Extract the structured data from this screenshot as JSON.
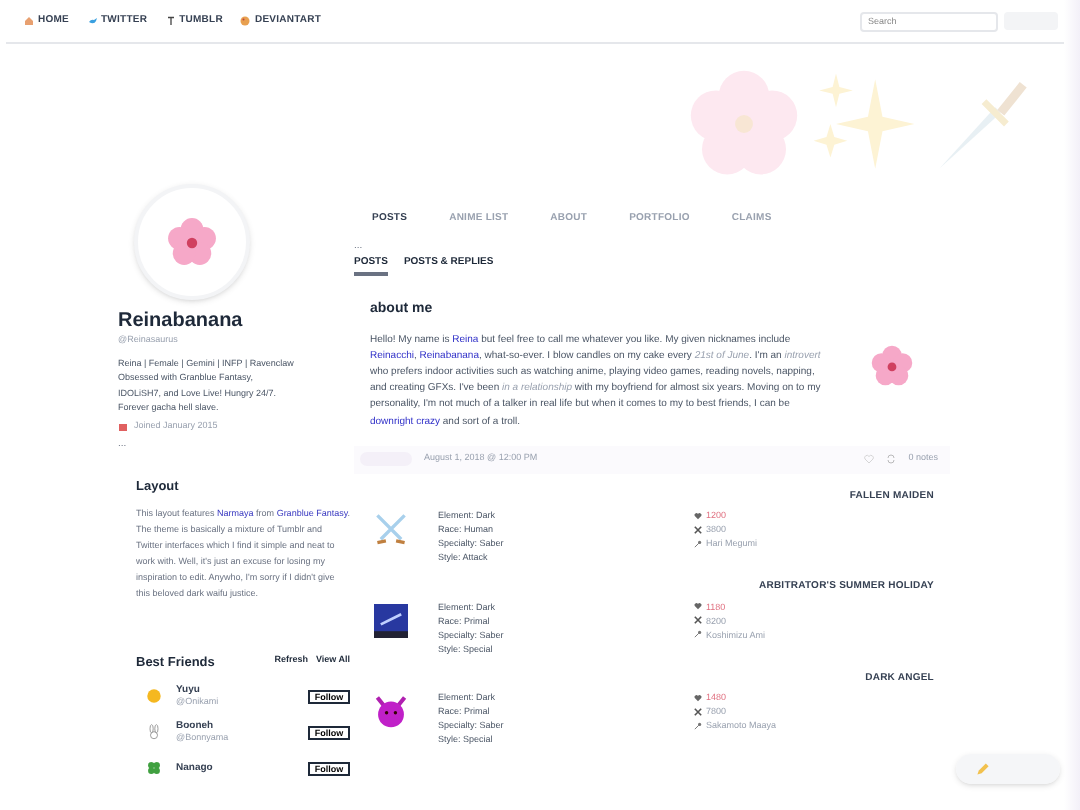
{
  "nav": {
    "links": [
      {
        "kind": "home",
        "label": "HOME"
      },
      {
        "kind": "bird",
        "label": "TWITTER"
      },
      {
        "kind": "t",
        "label": "TUMBLR"
      },
      {
        "kind": "palette",
        "label": "DEVIANTART"
      }
    ],
    "search": {
      "placeholder": "Search"
    }
  },
  "profile": {
    "name": "Reinabanana",
    "handle": "@Reinasaurus",
    "bio": [
      "Reina | Female | Gemini | INFP | Ravenclaw",
      "Obsessed with Granblue Fantasy,",
      "IDOLiSH7, and Love Live! Hungry 24/7.",
      "Forever gacha hell slave."
    ],
    "joined": "Joined January 2015",
    "more": "..."
  },
  "layout_box": {
    "title": "Layout",
    "text": [
      {
        "kind": "text",
        "text": "This layout features "
      },
      {
        "kind": "link",
        "text": "Narmaya"
      },
      {
        "kind": "text",
        "text": " from "
      },
      {
        "kind": "link",
        "text": "Granblue Fantasy"
      },
      {
        "kind": "text",
        "text": ". The theme is basically a mixture of Tumblr and Twitter interfaces which I find it simple and neat to work with. Well, it's just an excuse for losing my inspiration to edit. Anywho, I'm sorry if I didn't give this beloved dark waifu justice."
      }
    ]
  },
  "best_friends": {
    "title": "Best Friends",
    "actions": [
      "Refresh",
      "View All"
    ],
    "friends": [
      {
        "kind": "sun",
        "name": "Yuyu",
        "handle": "@Onikami",
        "button": "Follow"
      },
      {
        "kind": "bunny",
        "name": "Booneh",
        "handle": "@Bonnyama",
        "button": "Follow"
      },
      {
        "kind": "clover",
        "name": "Nanago",
        "button": "Follow"
      }
    ]
  },
  "tabs": [
    {
      "label": "POSTS",
      "selected": true
    },
    {
      "label": "ANIME LIST",
      "selected": false
    },
    {
      "label": "ABOUT",
      "selected": false
    },
    {
      "label": "PORTFOLIO",
      "selected": false
    },
    {
      "label": "CLAIMS",
      "selected": false
    }
  ],
  "more": "...",
  "subtabs": [
    {
      "label": "POSTS",
      "selected": true
    },
    {
      "label": "POSTS & REPLIES",
      "selected": false
    }
  ],
  "post": {
    "title": "about me",
    "text": [
      {
        "kind": "text",
        "text": "Hello! My name is "
      },
      {
        "kind": "link",
        "text": "Reina"
      },
      {
        "kind": "text",
        "text": " but feel free to call me whatever you like. My given nicknames include "
      },
      {
        "kind": "link",
        "text": "Reinacchi"
      },
      {
        "kind": "text",
        "text": ", "
      },
      {
        "kind": "link",
        "text": "Reinabanana"
      },
      {
        "kind": "text",
        "text": ", what-so-ever. I blow candles on my cake every "
      },
      {
        "kind": "em",
        "text": "21st of June"
      },
      {
        "kind": "text",
        "text": ". I'm an "
      },
      {
        "kind": "em",
        "text": "introvert"
      },
      {
        "kind": "text",
        "text": " who prefers indoor activities such as watching anime, playing video games, reading novels, napping, and creating GFXs. I've been "
      },
      {
        "kind": "em",
        "text": "in a relationship"
      },
      {
        "kind": "text",
        "text": " with my boyfriend for almost six years. Moving on to my personality, I'm not much of a talker in real life but when it comes to my to best friends, I can be "
      },
      {
        "kind": "link",
        "text": "downright crazy"
      },
      {
        "kind": "text",
        "text": " and sort of a troll."
      }
    ],
    "date": "August 1, 2018 @ 12:00 PM",
    "notes": "0 notes"
  },
  "characters": [
    {
      "kind": "swords",
      "title": "FALLEN MAIDEN",
      "stats": [
        "Element: Dark",
        "Race: Human",
        "Specialty: Saber",
        "Style: Attack"
      ],
      "hp": "1200",
      "atk": "3800",
      "voice": "Hari Megumi"
    },
    {
      "kind": "picture",
      "title": "ARBITRATOR'S SUMMER HOLIDAY",
      "stats": [
        "Element: Dark",
        "Race: Primal",
        "Specialty: Saber",
        "Style: Special"
      ],
      "hp": "1180",
      "atk": "8200",
      "voice": "Koshimizu Ami"
    },
    {
      "kind": "devil",
      "title": "DARK ANGEL",
      "stats": [
        "Element: Dark",
        "Race: Primal",
        "Specialty: Saber",
        "Style: Special"
      ],
      "hp": "1480",
      "atk": "7800",
      "voice": "Sakamoto Maaya"
    }
  ]
}
